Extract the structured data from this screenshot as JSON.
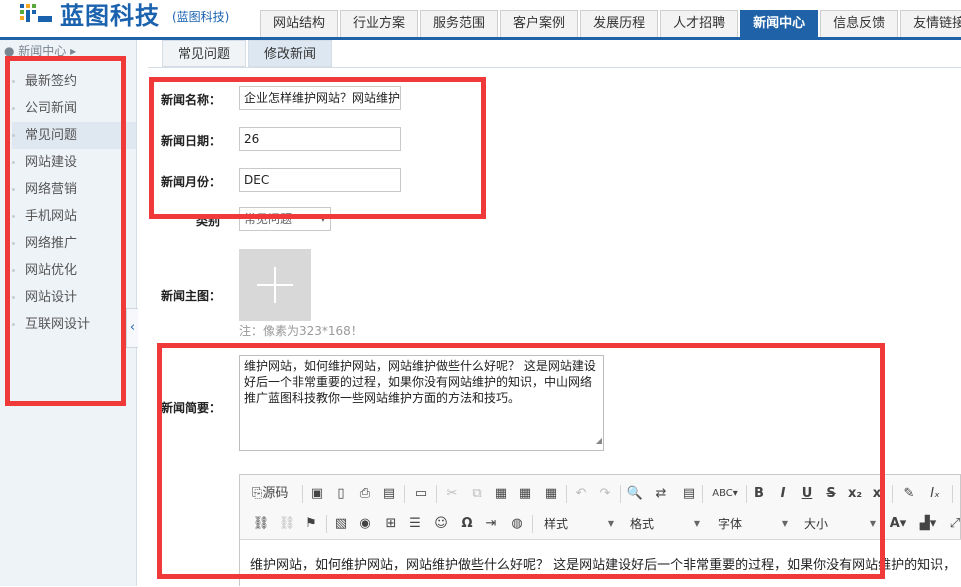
{
  "brand": {
    "name": "蓝图科技",
    "subtitle": "(蓝图科技)",
    "logo_colors": [
      "#1a62ae",
      "#f5a623",
      "#58a83b"
    ]
  },
  "nav": {
    "tabs": [
      "网站结构",
      "行业方案",
      "服务范围",
      "客户案例",
      "发展历程",
      "人才招聘",
      "新闻中心",
      "信息反馈",
      "友情链接"
    ],
    "active": "新闻中心"
  },
  "sidebar": {
    "header": "新闻中心",
    "items": [
      "最新签约",
      "公司新闻",
      "常见问题",
      "网站建设",
      "网络营销",
      "手机网站",
      "网络推广",
      "网站优化",
      "网站设计",
      "互联网设计"
    ],
    "active": "常见问题",
    "collapse_icon": "‹"
  },
  "subtabs": {
    "tabs": [
      "常见问题",
      "修改新闻"
    ],
    "active": "修改新闻"
  },
  "form": {
    "name_label": "新闻名称：",
    "name_value": "企业怎样维护网站？网站维护",
    "date_label": "新闻日期：",
    "date_value": "26",
    "month_label": "新闻月份：",
    "month_value": "DEC",
    "category_label": "类别",
    "category_value": "常见问题",
    "image_label": "新闻主图：",
    "image_hint": "注：像素为323*168！",
    "summary_label": "新闻简要：",
    "summary_text": "维护网站，如何维护网站，网站维护做些什么好呢？ 这是网站建设好后一个非常重要的过程，如果你没有网站维护的知识，中山网络推广蓝图科技教你一些网站维护方面的方法和技巧。"
  },
  "editor": {
    "source_label": "源码",
    "combos": [
      "样式",
      "格式",
      "字体",
      "大小"
    ],
    "body_text": "维护网站，如何维护网站，网站维护做些什么好呢？ 这是网站建设好后一个非常重要的过程，如果你没有网站维护的知识，"
  },
  "colors": {
    "primary": "#1f62a8",
    "highlight": "#f03a3a"
  }
}
